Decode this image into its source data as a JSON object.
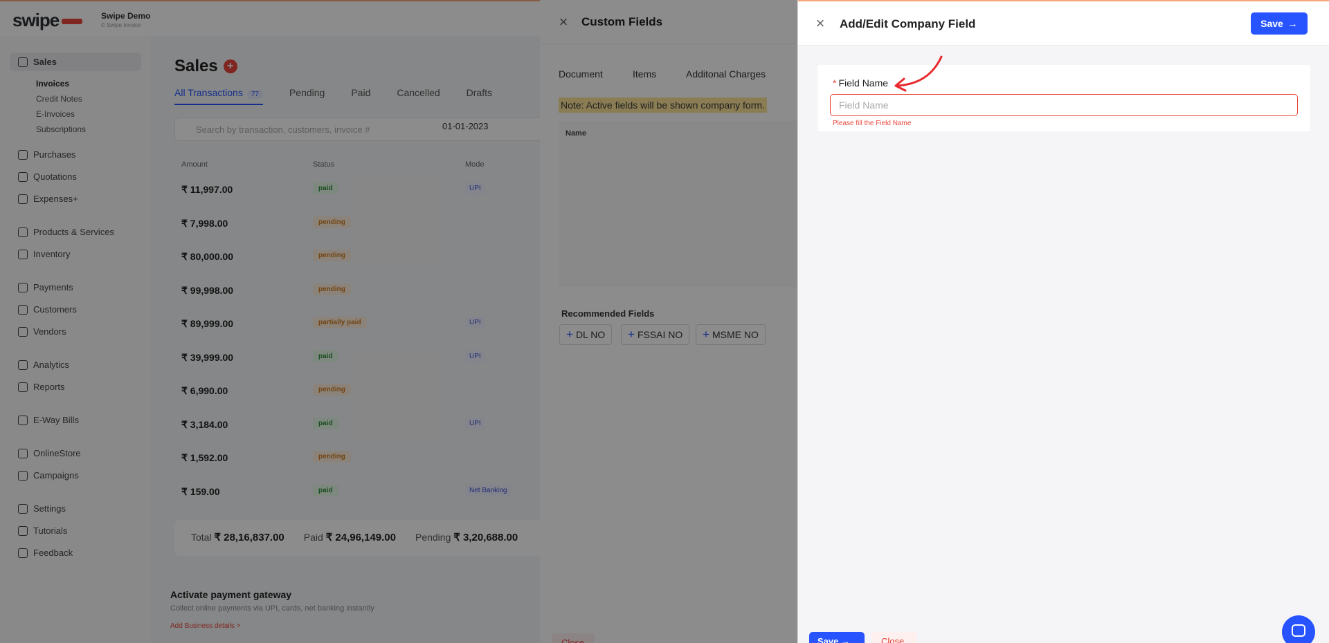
{
  "app": {
    "brand": "swipe",
    "company_name": "Swipe Demo",
    "company_sub": "© Swipe Invoice"
  },
  "sidebar": {
    "items": [
      {
        "label": "Sales"
      },
      {
        "label": "Purchases"
      },
      {
        "label": "Quotations"
      },
      {
        "label": "Expenses+"
      },
      {
        "label": "Products & Services"
      },
      {
        "label": "Inventory"
      },
      {
        "label": "Payments"
      },
      {
        "label": "Customers"
      },
      {
        "label": "Vendors"
      },
      {
        "label": "Analytics"
      },
      {
        "label": "Reports"
      },
      {
        "label": "E-Way Bills"
      },
      {
        "label": "OnlineStore"
      },
      {
        "label": "Campaigns"
      },
      {
        "label": "Settings"
      },
      {
        "label": "Tutorials"
      },
      {
        "label": "Feedback"
      }
    ],
    "sales_sub": [
      "Invoices",
      "Credit Notes",
      "E-Invoices",
      "Subscriptions"
    ]
  },
  "sales": {
    "title": "Sales",
    "tabs": [
      "All Transactions",
      "Pending",
      "Paid",
      "Cancelled",
      "Drafts"
    ],
    "all_count": "77",
    "search_placeholder": "Search by transaction, customers, invoice #",
    "date": "01-01-2023",
    "columns": [
      "Amount",
      "Status",
      "Mode"
    ],
    "rows": [
      {
        "amount": "₹ 11,997.00",
        "status": "paid",
        "mode": "UPI"
      },
      {
        "amount": "₹ 7,998.00",
        "status": "pending",
        "mode": ""
      },
      {
        "amount": "₹ 80,000.00",
        "status": "pending",
        "mode": ""
      },
      {
        "amount": "₹ 99,998.00",
        "status": "pending",
        "mode": ""
      },
      {
        "amount": "₹ 89,999.00",
        "status": "partially paid",
        "mode": "UPI"
      },
      {
        "amount": "₹ 39,999.00",
        "status": "paid",
        "mode": "UPI"
      },
      {
        "amount": "₹ 6,990.00",
        "status": "pending",
        "mode": ""
      },
      {
        "amount": "₹ 3,184.00",
        "status": "paid",
        "mode": "UPI"
      },
      {
        "amount": "₹ 1,592.00",
        "status": "pending",
        "mode": ""
      },
      {
        "amount": "₹ 159.00",
        "status": "paid",
        "mode": "Net Banking"
      }
    ],
    "totals": {
      "total_label": "Total",
      "total": "₹ 28,16,837.00",
      "paid_label": "Paid",
      "paid": "₹ 24,96,149.00",
      "pending_label": "Pending",
      "pending": "₹ 3,20,688.00"
    },
    "gateway": {
      "title": "Activate payment gateway",
      "desc": "Collect online payments via UPI, cards, net banking instantly",
      "link": "Add Business details >"
    }
  },
  "custom_fields": {
    "title": "Custom Fields",
    "tabs": [
      "Document",
      "Items",
      "Additonal Charges"
    ],
    "note": "Note: Active fields will be shown company form.",
    "table_header": "Name",
    "recommended_title": "Recommended Fields",
    "recommended": [
      "DL NO",
      "FSSAI NO",
      "MSME NO"
    ],
    "close_label": "Close"
  },
  "edit_drawer": {
    "title": "Add/Edit Company Field",
    "save_label": "Save",
    "field_label": "Field Name",
    "field_placeholder": "Field Name",
    "field_value": "",
    "error": "Please fill the Field Name",
    "footer_save": "Save",
    "footer_close": "Close"
  },
  "colors": {
    "accent": "#2754ff",
    "error": "#e8453c",
    "note_bg": "#fbe39a"
  }
}
